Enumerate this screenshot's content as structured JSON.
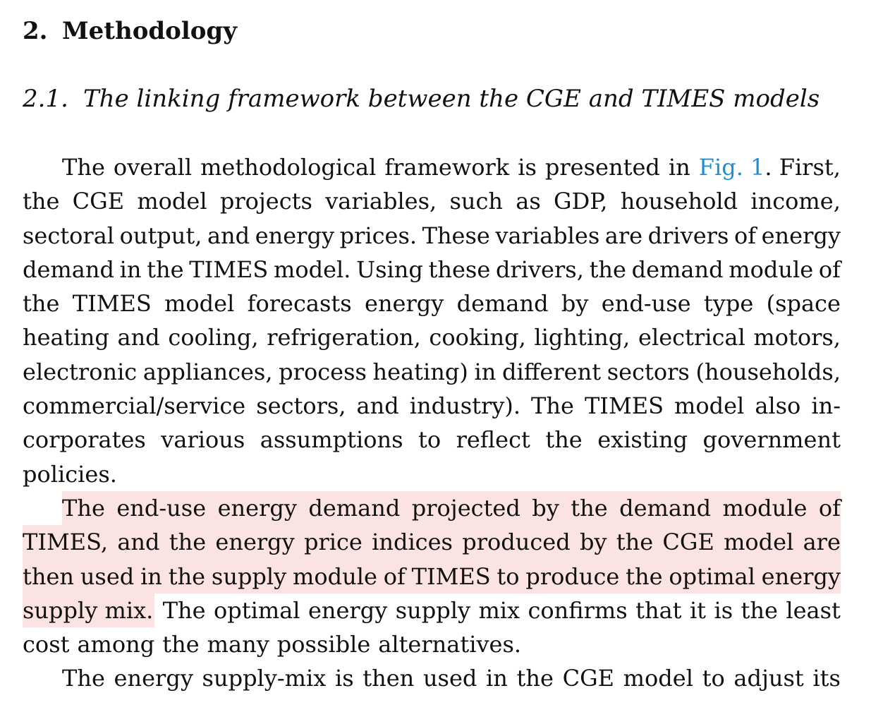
{
  "section": {
    "number": "2.",
    "title": "Methodology"
  },
  "subsection": {
    "number": "2.1.",
    "title": "The linking framework between the CGE and TIMES models"
  },
  "paragraphs": [
    {
      "lines": [
        {
          "words": [
            "The",
            "overall",
            "methodological",
            "framework",
            "is",
            "presented",
            "in"
          ],
          "link": "Fig. 1",
          "after_link": ". First,"
        },
        {
          "words": [
            "the",
            "CGE",
            "model",
            "projects",
            "variables,",
            "such",
            "as",
            "GDP,",
            "household",
            "income,"
          ]
        },
        {
          "words": [
            "sectoral",
            "output,",
            "and",
            "energy",
            "prices.",
            "These",
            "variables",
            "are",
            "drivers",
            "of",
            "energy"
          ]
        },
        {
          "words": [
            "demand",
            "in",
            "the",
            "TIMES",
            "model.",
            "Using",
            "these",
            "drivers,",
            "the",
            "demand",
            "module",
            "of"
          ]
        },
        {
          "words": [
            "the",
            "TIMES",
            "model",
            "forecasts",
            "energy",
            "demand",
            "by",
            "end-use",
            "type",
            "(space"
          ]
        },
        {
          "words": [
            "heating",
            "and",
            "cooling,",
            "refrigeration,",
            "cooking,",
            "lighting,",
            "electrical",
            "motors,"
          ]
        },
        {
          "words": [
            "electronic",
            "appliances,",
            "process",
            "heating)",
            "in",
            "different",
            "sectors",
            "(households,"
          ]
        },
        {
          "words": [
            "commercial/service",
            "sectors,",
            "and",
            "industry).",
            "The",
            "TIMES",
            "model",
            "also",
            "in-"
          ]
        },
        {
          "words": [
            "corporates",
            "various",
            "assumptions",
            "to",
            "reflect",
            "the",
            "existing",
            "government"
          ]
        },
        {
          "words": [
            "policies."
          ]
        }
      ]
    },
    {
      "lines": [
        {
          "words": [
            "The",
            "end-use",
            "energy",
            "demand",
            "projected",
            "by",
            "the",
            "demand",
            "module",
            "of"
          ]
        },
        {
          "words": [
            "TIMES,",
            "and",
            "the",
            "energy",
            "price",
            "indices",
            "produced",
            "by",
            "the",
            "CGE",
            "model",
            "are"
          ]
        },
        {
          "words": [
            "then",
            "used",
            "in",
            "the",
            "supply",
            "module",
            "of",
            "TIMES",
            "to",
            "produce",
            "the",
            "optimal",
            "energy"
          ]
        },
        {
          "highlight_words": [
            "supply",
            "mix."
          ],
          "words": [
            "The",
            "optimal",
            "energy",
            "supply",
            "mix",
            "confirms",
            "that",
            "it",
            "is",
            "the",
            "least"
          ]
        },
        {
          "words": [
            "cost",
            "among",
            "the",
            "many",
            "possible",
            "alternatives."
          ]
        }
      ]
    },
    {
      "lines": [
        {
          "words": [
            "The",
            "energy",
            "supply-mix",
            "is",
            "then",
            "used",
            "in",
            "the",
            "CGE",
            "model",
            "to",
            "adjust",
            "its"
          ]
        }
      ]
    }
  ]
}
